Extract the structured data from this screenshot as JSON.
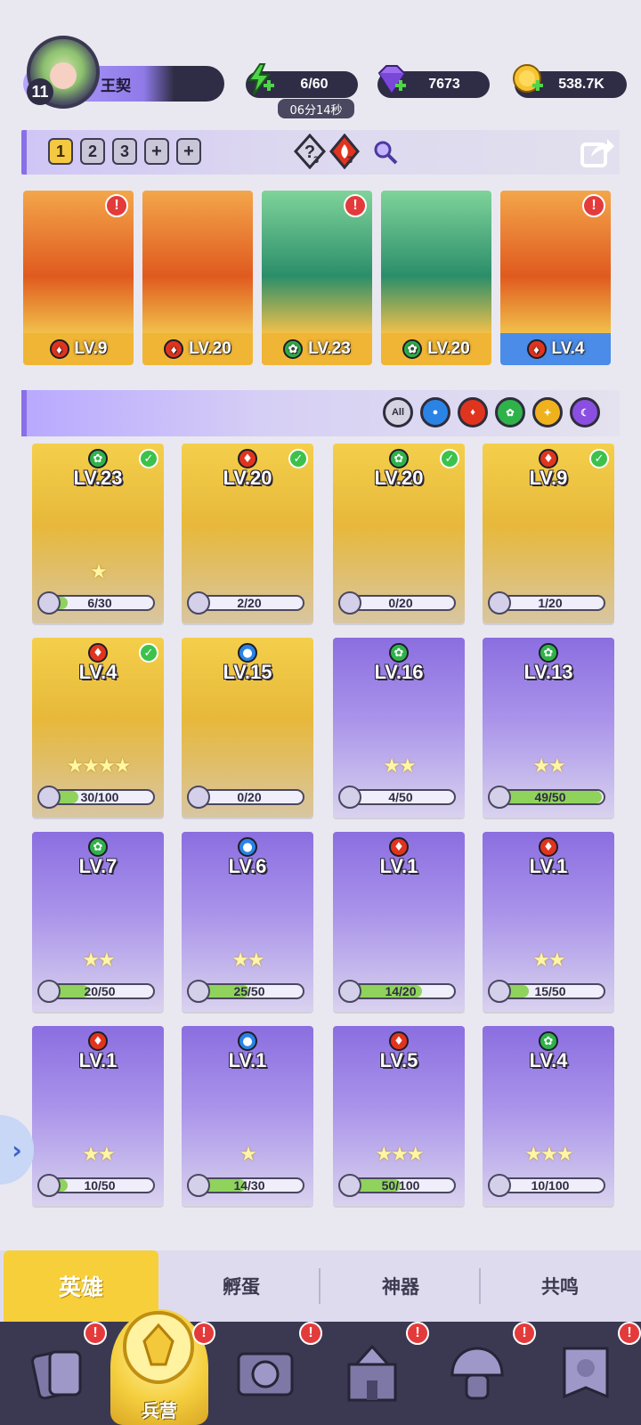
{
  "player": {
    "level": "11",
    "name": "王契"
  },
  "resources": {
    "energy": "6/60",
    "energy_timer": "06分14秒",
    "gems": "7673",
    "gold": "538.7K"
  },
  "team_bar": {
    "slots": [
      "1",
      "2",
      "3"
    ],
    "hint_count": "3",
    "fire_count": "3"
  },
  "team": [
    {
      "element": "fire",
      "level": "LV.9",
      "alert": true
    },
    {
      "element": "fire",
      "level": "LV.20",
      "alert": false
    },
    {
      "element": "nature",
      "level": "LV.23",
      "alert": true
    },
    {
      "element": "nature",
      "level": "LV.20",
      "alert": false
    },
    {
      "element": "fire",
      "level": "LV.4",
      "alert": true
    }
  ],
  "filters": [
    {
      "label": "All",
      "element": "all"
    },
    {
      "label": "",
      "element": "water"
    },
    {
      "label": "",
      "element": "fire"
    },
    {
      "label": "",
      "element": "nature"
    },
    {
      "label": "",
      "element": "light"
    },
    {
      "label": "",
      "element": "dark"
    }
  ],
  "heroes": [
    {
      "level": "LV.23",
      "element": "nature",
      "progress": "6/30",
      "fraction": 0.2,
      "stars": 1,
      "checked": true,
      "tone": "gold"
    },
    {
      "level": "LV.20",
      "element": "fire",
      "progress": "2/20",
      "fraction": 0.1,
      "stars": 0,
      "checked": true,
      "tone": "gold"
    },
    {
      "level": "LV.20",
      "element": "nature",
      "progress": "0/20",
      "fraction": 0.0,
      "stars": 0,
      "checked": true,
      "tone": "gold"
    },
    {
      "level": "LV.9",
      "element": "fire",
      "progress": "1/20",
      "fraction": 0.05,
      "stars": 0,
      "checked": true,
      "tone": "gold"
    },
    {
      "level": "LV.4",
      "element": "fire",
      "progress": "30/100",
      "fraction": 0.3,
      "stars": 4,
      "checked": true,
      "tone": "gold"
    },
    {
      "level": "LV.15",
      "element": "water",
      "progress": "0/20",
      "fraction": 0.0,
      "stars": 0,
      "checked": false,
      "tone": "gold"
    },
    {
      "level": "LV.16",
      "element": "nature",
      "progress": "4/50",
      "fraction": 0.08,
      "stars": 2,
      "checked": false,
      "tone": "purple"
    },
    {
      "level": "LV.13",
      "element": "nature",
      "progress": "49/50",
      "fraction": 0.98,
      "stars": 2,
      "checked": false,
      "tone": "purple"
    },
    {
      "level": "LV.7",
      "element": "nature",
      "progress": "20/50",
      "fraction": 0.4,
      "stars": 2,
      "checked": false,
      "tone": "purple"
    },
    {
      "level": "LV.6",
      "element": "water",
      "progress": "25/50",
      "fraction": 0.5,
      "stars": 2,
      "checked": false,
      "tone": "purple"
    },
    {
      "level": "LV.1",
      "element": "fire",
      "progress": "14/20",
      "fraction": 0.7,
      "stars": 0,
      "checked": false,
      "tone": "purple"
    },
    {
      "level": "LV.1",
      "element": "fire",
      "progress": "15/50",
      "fraction": 0.3,
      "stars": 2,
      "checked": false,
      "tone": "purple"
    },
    {
      "level": "LV.1",
      "element": "fire",
      "progress": "10/50",
      "fraction": 0.2,
      "stars": 2,
      "checked": false,
      "tone": "purple"
    },
    {
      "level": "LV.1",
      "element": "water",
      "progress": "14/30",
      "fraction": 0.47,
      "stars": 1,
      "checked": false,
      "tone": "purple"
    },
    {
      "level": "LV.5",
      "element": "fire",
      "progress": "50/100",
      "fraction": 0.5,
      "stars": 3,
      "checked": false,
      "tone": "purple"
    },
    {
      "level": "LV.4",
      "element": "nature",
      "progress": "10/100",
      "fraction": 0.1,
      "stars": 3,
      "checked": false,
      "tone": "purple"
    }
  ],
  "subtabs": {
    "heroes": "英雄",
    "hatch": "孵蛋",
    "artifacts": "神器",
    "resonance": "共鸣"
  },
  "nav": {
    "barracks": "兵营"
  },
  "colors": {
    "accent_gold": "#f6cf3b",
    "accent_purple": "#8a6fe8",
    "nav_bg": "#3b3852",
    "alert_red": "#e33b3b"
  }
}
